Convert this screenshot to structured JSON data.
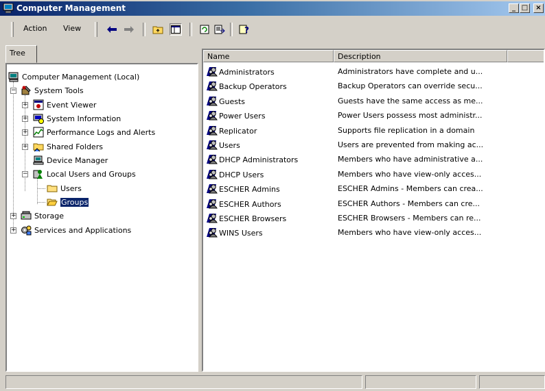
{
  "window": {
    "title": "Computer Management",
    "controls": {
      "minimize": "_",
      "maximize": "□",
      "close": "×"
    }
  },
  "menu": {
    "action": "Action",
    "view": "View"
  },
  "toolbar_icons": [
    "back-arrow-icon",
    "forward-arrow-icon",
    "up-folder-icon",
    "show-hide-tree-icon",
    "refresh-icon",
    "export-list-icon",
    "help-icon"
  ],
  "tree": {
    "tab_label": "Tree",
    "items": [
      {
        "label": "Computer Management (Local)"
      },
      {
        "label": "System Tools"
      },
      {
        "label": "Event Viewer"
      },
      {
        "label": "System Information"
      },
      {
        "label": "Performance Logs and Alerts"
      },
      {
        "label": "Shared Folders"
      },
      {
        "label": "Device Manager"
      },
      {
        "label": "Local Users and Groups"
      },
      {
        "label": "Users"
      },
      {
        "label": "Groups"
      },
      {
        "label": "Storage"
      },
      {
        "label": "Services and Applications"
      }
    ]
  },
  "list": {
    "columns": {
      "name": "Name",
      "description": "Description"
    },
    "rows": [
      {
        "name": "Administrators",
        "description": "Administrators have complete and u..."
      },
      {
        "name": "Backup Operators",
        "description": "Backup Operators can override secu..."
      },
      {
        "name": "Guests",
        "description": "Guests have the same access as me..."
      },
      {
        "name": "Power Users",
        "description": "Power Users possess most administr..."
      },
      {
        "name": "Replicator",
        "description": "Supports file replication in a domain"
      },
      {
        "name": "Users",
        "description": "Users are prevented from making ac..."
      },
      {
        "name": "DHCP Administrators",
        "description": "Members who have administrative a..."
      },
      {
        "name": "DHCP Users",
        "description": "Members who have view-only acces..."
      },
      {
        "name": "ESCHER Admins",
        "description": "ESCHER Admins - Members can crea..."
      },
      {
        "name": "ESCHER Authors",
        "description": "ESCHER Authors - Members can cre..."
      },
      {
        "name": "ESCHER Browsers",
        "description": "ESCHER Browsers - Members can re..."
      },
      {
        "name": "WINS Users",
        "description": "Members who have view-only acces..."
      }
    ]
  },
  "colors": {
    "title_active": "#0a246a",
    "selection": "#0a246a",
    "face": "#d4d0c8"
  }
}
